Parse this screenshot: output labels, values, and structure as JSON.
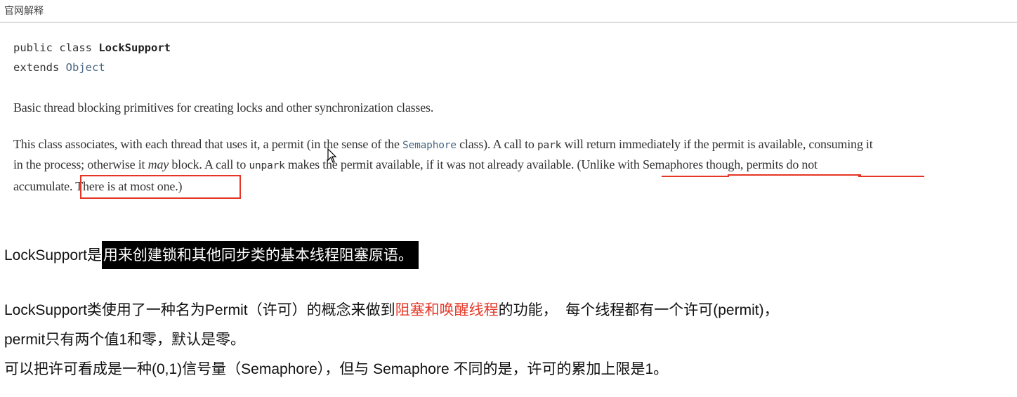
{
  "header": {
    "title": "官网解释"
  },
  "javadoc": {
    "decl_line1": {
      "prefix": "public class ",
      "class_name": "LockSupport"
    },
    "decl_line2": {
      "prefix": "extends ",
      "parent": "Object"
    },
    "summary": "Basic thread blocking primitives for creating locks and other synchronization classes.",
    "para": {
      "l1_a": "This class associates, with each thread that uses it, a permit (in the sense of the ",
      "l1_code": "Semaphore",
      "l1_b": " class). A call to ",
      "l1_code2": "park",
      "l1_c": " will return immediately if the permit is available, consuming it",
      "l2_a": "in the process; otherwise it ",
      "l2_italic": "may",
      "l2_b": " block. A call to ",
      "l2_code": "unpark",
      "l2_c": " makes the permit available, if it was not already available. (Unlike with Semaphores though, permits do not",
      "l3_a": "accumulate. ",
      "l3_b": "There is at most one.)"
    }
  },
  "notes": {
    "line1_prefix": "LockSupport是",
    "line1_highlight": "用来创建锁和其他同步类的基本线程阻塞原语。",
    "line2_a": "LockSupport类使用了一种名为Permit（许可）的概念来做到",
    "line2_red": "阻塞和唤醒线程",
    "line2_b": "的功能，  每个线程都有一个许可(permit)，",
    "line3": "permit只有两个值1和零，默认是零。",
    "line4": "可以把许可看成是一种(0,1)信号量（Semaphore），但与 Semaphore 不同的是，许可的累加上限是1。"
  },
  "colors": {
    "annotation_red": "#e53525",
    "link_blue": "#4a6782",
    "highlight_bg": "#000000"
  }
}
